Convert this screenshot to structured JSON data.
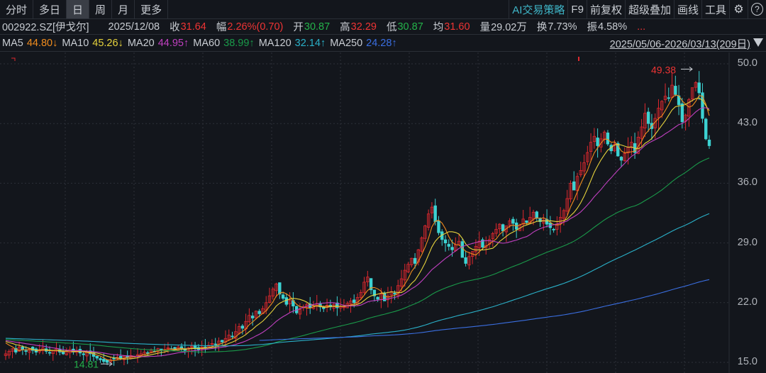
{
  "toolbar": {
    "tabs": [
      {
        "label": "分时"
      },
      {
        "label": "多日"
      },
      {
        "label": "日",
        "selected": true
      },
      {
        "label": "周"
      },
      {
        "label": "月"
      },
      {
        "label": "更多"
      }
    ],
    "right": {
      "ai": "AI交易策略",
      "f9": "F9",
      "adjust": "前复权",
      "overlay": "超级叠加",
      "draw": "画线",
      "tools": "工具",
      "settings_icon": "gear-icon",
      "help_icon": "help-icon"
    }
  },
  "info": {
    "code": "002922.SZ[伊戈尔]",
    "date": "2025/12/08",
    "close_label": "收",
    "close": "31.64",
    "chg_label": "幅",
    "chg": "2.26%(0.70)",
    "open_label": "开",
    "open": "30.87",
    "high_label": "高",
    "high": "32.29",
    "low_label": "低",
    "low": "30.87",
    "avg_label": "均",
    "avg": "31.60",
    "vol_label": "量",
    "vol": "29.02万",
    "turn_label": "换",
    "turn": "7.73%",
    "amp_label": "振",
    "amp": "4.58%",
    "more": "..."
  },
  "ma": [
    {
      "name": "MA5",
      "value": "44.80↓",
      "color": "#f08c1e"
    },
    {
      "name": "MA10",
      "value": "45.26↓",
      "color": "#e6d23c"
    },
    {
      "name": "MA20",
      "value": "44.95↑",
      "color": "#c040c0"
    },
    {
      "name": "MA60",
      "value": "38.99↑",
      "color": "#1a9a4a"
    },
    {
      "name": "MA120",
      "value": "32.14↑",
      "color": "#2ab0c8"
    },
    {
      "name": "MA250",
      "value": "24.28↑",
      "color": "#3a6ee0"
    }
  ],
  "range": "2025/05/06-2026/03/13(209日)",
  "chart_data": {
    "type": "candlestick",
    "ylim": [
      15.0,
      50.0
    ],
    "yticks": [
      "50.0",
      "43.0",
      "36.0",
      "29.0",
      "22.0",
      "15.0"
    ],
    "up_color": "#e0282e",
    "down_color": "#3cd2d2",
    "max_label": "49.38",
    "min_label": "14.81",
    "close": [
      16.0,
      16.3,
      16.6,
      16.2,
      16.8,
      16.5,
      16.3,
      16.6,
      16.4,
      16.2,
      16.5,
      16.7,
      16.3,
      16.1,
      16.4,
      16.6,
      16.2,
      16.0,
      16.3,
      16.5,
      16.2,
      16.4,
      16.1,
      15.9,
      16.2,
      16.0,
      15.7,
      15.5,
      15.3,
      15.1,
      15.0,
      15.3,
      15.4,
      15.6,
      15.5,
      15.7,
      15.6,
      15.8,
      15.7,
      15.9,
      16.0,
      16.2,
      16.1,
      16.5,
      16.3,
      16.6,
      16.4,
      16.5,
      16.7,
      16.6,
      16.5,
      16.8,
      16.6,
      16.4,
      16.7,
      16.9,
      16.6,
      16.5,
      16.8,
      16.7,
      17.0,
      17.2,
      17.1,
      17.5,
      17.4,
      17.8,
      18.2,
      18.0,
      18.6,
      19.2,
      19.0,
      19.8,
      20.5,
      20.2,
      21.0,
      20.7,
      21.3,
      22.0,
      22.8,
      23.6,
      24.2,
      23.0,
      22.5,
      21.8,
      22.3,
      21.6,
      20.8,
      21.2,
      21.5,
      21.8,
      21.4,
      21.6,
      21.9,
      21.5,
      21.3,
      21.7,
      21.5,
      21.8,
      21.4,
      21.6,
      21.5,
      21.9,
      22.2,
      22.0,
      22.6,
      23.2,
      24.4,
      25.0,
      23.5,
      22.8,
      22.4,
      23.0,
      22.2,
      22.8,
      23.3,
      23.0,
      24.0,
      24.8,
      25.8,
      26.5,
      27.2,
      26.6,
      28.2,
      29.6,
      31.0,
      32.4,
      33.2,
      31.5,
      30.2,
      29.4,
      29.0,
      28.6,
      28.2,
      28.8,
      29.2,
      27.3,
      26.6,
      27.4,
      28.0,
      28.6,
      29.2,
      28.5,
      28.7,
      29.4,
      30.1,
      30.6,
      31.2,
      30.4,
      31.0,
      31.6,
      31.3,
      30.6,
      31.1,
      31.8,
      31.4,
      32.0,
      32.6,
      31.9,
      31.5,
      31.7,
      31.2,
      30.8,
      30.6,
      31.2,
      32.0,
      32.8,
      34.2,
      36.0,
      35.2,
      36.8,
      37.5,
      38.4,
      39.6,
      40.8,
      41.5,
      40.4,
      41.2,
      42.0,
      40.6,
      39.8,
      40.6,
      39.2,
      38.7,
      39.5,
      40.2,
      40.8,
      39.6,
      41.4,
      42.6,
      44.2,
      43.0,
      42.4,
      43.6,
      44.8,
      45.6,
      46.2,
      46.0,
      47.5,
      46.4,
      45.2,
      43.2,
      44.0,
      45.8,
      47.2,
      47.8,
      46.6,
      43.6,
      41.2,
      40.4
    ]
  }
}
